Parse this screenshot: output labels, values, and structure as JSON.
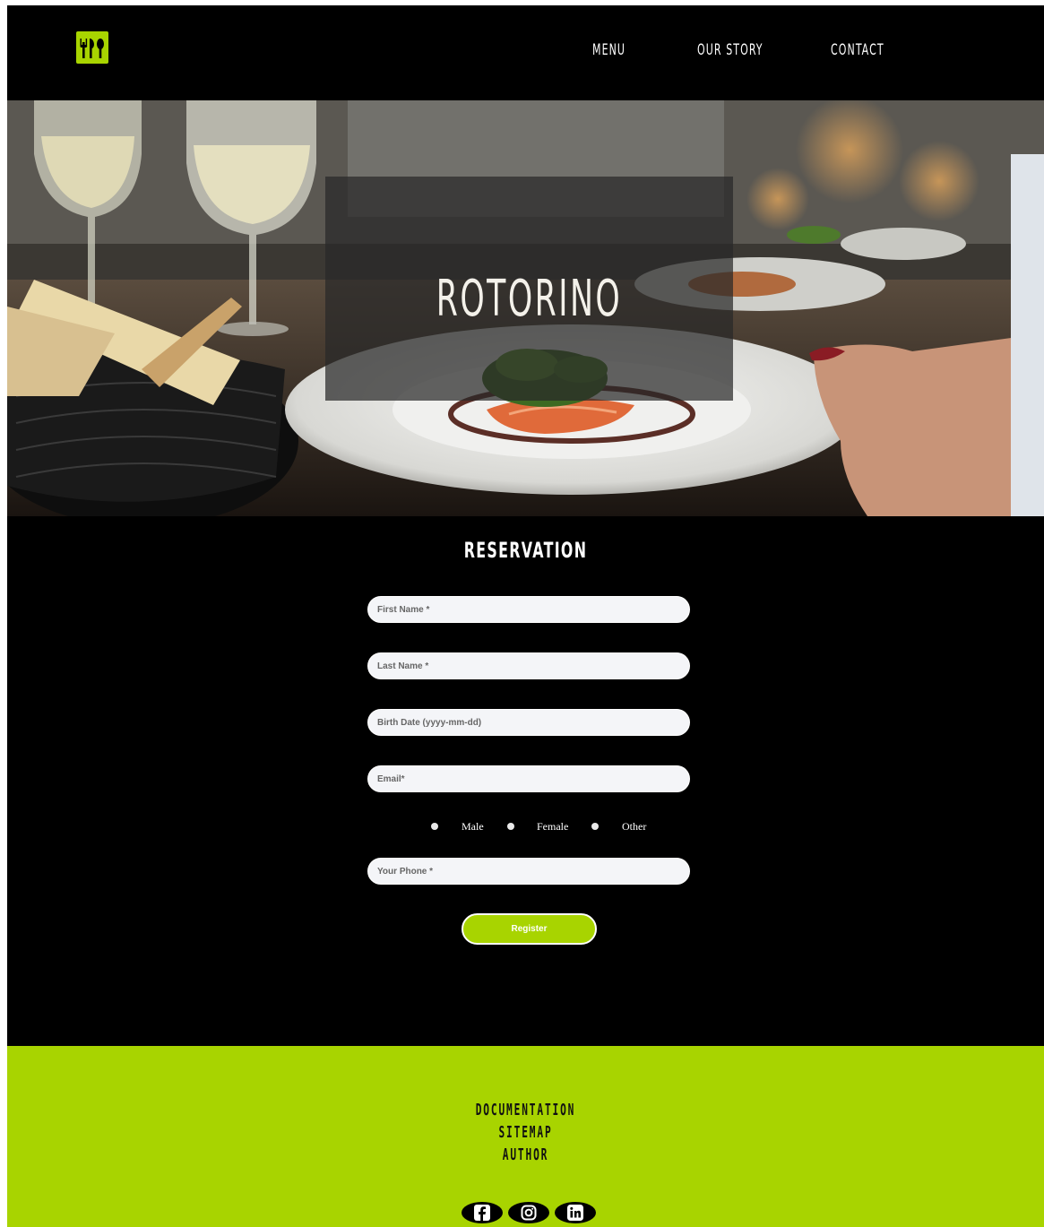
{
  "nav": {
    "links": [
      "MENU",
      "OUR STORY",
      "CONTACT"
    ],
    "logo_icon": "fork-knife-spoon-icon"
  },
  "hero": {
    "title": "ROTORINO"
  },
  "reservation": {
    "title": "RESERVATION",
    "fields": {
      "first_name": "First Name *",
      "last_name": "Last Name *",
      "birth_date": "Birth Date (yyyy-mm-dd)",
      "email": "Email*",
      "phone": "Your Phone *"
    },
    "gender_options": [
      "Male",
      "Female",
      "Other"
    ],
    "submit_label": "Register"
  },
  "footer": {
    "links": [
      "DOCUMENTATION",
      "SITEMAP",
      "AUTHOR"
    ],
    "social": [
      "facebook-icon",
      "instagram-icon",
      "linkedin-icon"
    ]
  },
  "colors": {
    "accent": "#a8d400",
    "background": "#000000",
    "input": "#f4f5f8"
  }
}
